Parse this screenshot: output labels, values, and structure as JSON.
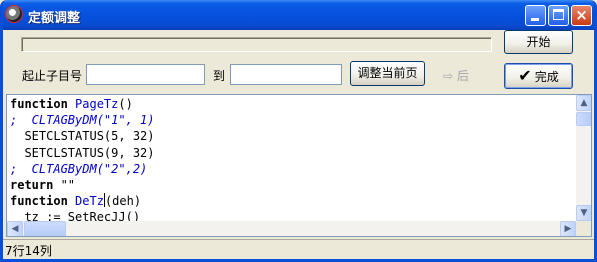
{
  "window": {
    "title": "定额调整",
    "controls": {
      "minimize": "_",
      "maximize": "□",
      "close": "×"
    }
  },
  "toolbar": {
    "start_label": "开始",
    "range_label": "起止子目号",
    "to_label": "到",
    "from_value": "",
    "to_value": "",
    "adjust_label": "调整当前页",
    "back_label": "⇨ 后",
    "done_label": "完成",
    "done_icon": "check-icon"
  },
  "progress": {
    "value": 0
  },
  "editor": {
    "lines": [
      [
        {
          "cls": "kw",
          "text": "function "
        },
        {
          "cls": "fn",
          "text": "PageTz"
        },
        {
          "cls": "txt",
          "text": "()"
        }
      ],
      [
        {
          "cls": "cmt",
          "text": ";  CLTAGByDM(\"1\", 1)"
        }
      ],
      [
        {
          "cls": "txt",
          "text": "  SETCLSTATUS(5, 32)"
        }
      ],
      [
        {
          "cls": "txt",
          "text": "  SETCLSTATUS(9, 32)"
        }
      ],
      [
        {
          "cls": "cmt",
          "text": ";  CLTAGByDM(\"2\",2)"
        }
      ],
      [
        {
          "cls": "kw",
          "text": "return "
        },
        {
          "cls": "txt",
          "text": "\"\""
        }
      ],
      [
        {
          "cls": "kw",
          "text": "function "
        },
        {
          "cls": "fn",
          "text": "DeTz"
        },
        {
          "cls": "cursor",
          "text": ""
        },
        {
          "cls": "txt",
          "text": "(deh)"
        }
      ],
      [
        {
          "cls": "txt",
          "text": "  tz := SetRecJJ()"
        }
      ]
    ]
  },
  "scrollbars": {
    "up": "▲",
    "down": "▼",
    "left": "◀",
    "right": "▶",
    "grip": "≡"
  },
  "status": {
    "text": "7行14列"
  }
}
